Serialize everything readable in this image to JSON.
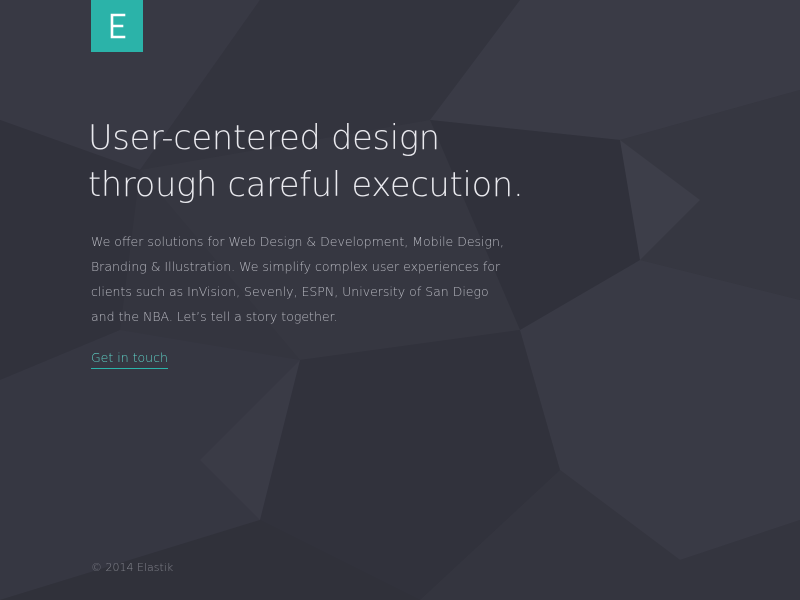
{
  "colors": {
    "background": "#34353f",
    "accent": "#2bb3a9",
    "heading": "#e9e9ee",
    "body_text": "#b8b9c1",
    "link": "#5fd2c7",
    "footer_text": "#85868f"
  },
  "logo": {
    "icon": "elastik-e-logo-icon"
  },
  "hero": {
    "headline": [
      "User-centered design",
      "through careful execution."
    ],
    "description": [
      "We offer solutions for Web Design & Development, Mobile Design,",
      "Branding & Illustration. We simplify complex user experiences for",
      "clients such as InVision, Sevenly, ESPN, University of San Diego",
      "and the NBA. Let’s tell a story together."
    ],
    "cta_label": "Get in touch"
  },
  "footer": {
    "copyright": "© 2014 Elastik"
  }
}
